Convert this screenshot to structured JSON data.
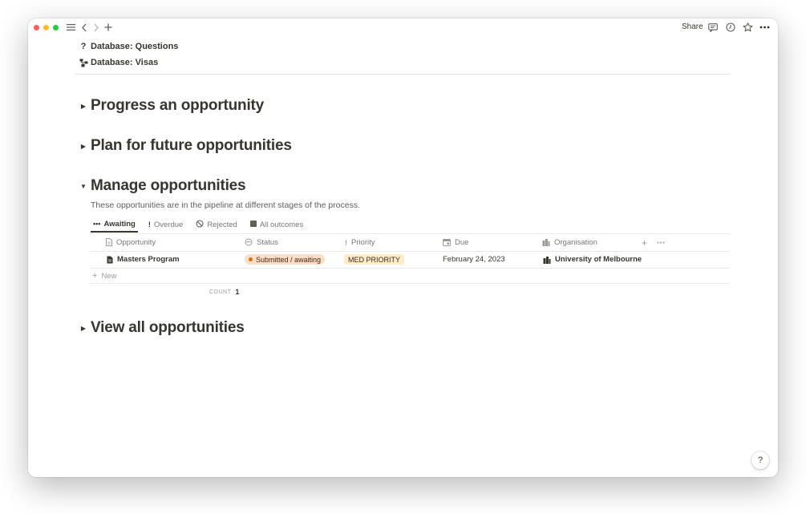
{
  "titlebar": {
    "share_label": "Share"
  },
  "links": [
    {
      "icon": "question-icon",
      "glyph": "?",
      "label": "Database: Questions"
    },
    {
      "icon": "visa-icon",
      "glyph": "⚑",
      "label": "Database: Visas"
    }
  ],
  "sections": [
    {
      "title": "Progress an opportunity",
      "expanded": false
    },
    {
      "title": "Plan for future opportunities",
      "expanded": false
    },
    {
      "title": "Manage opportunities",
      "expanded": true
    },
    {
      "title": "View all opportunities",
      "expanded": false
    }
  ],
  "manage": {
    "description": "These opportunities are in the pipeline at different stages of the process.",
    "tabs": [
      {
        "label": "Awaiting",
        "icon": "ellipsis-icon",
        "active": true
      },
      {
        "label": "Overdue",
        "icon": "exclamation-icon",
        "active": false
      },
      {
        "label": "Rejected",
        "icon": "prohibited-icon",
        "active": false
      },
      {
        "label": "All outcomes",
        "icon": "square-icon",
        "active": false
      }
    ],
    "columns": [
      "Opportunity",
      "Status",
      "Priority",
      "Due",
      "Organisation"
    ],
    "rows": [
      {
        "opportunity": "Masters Program",
        "status": "Submitted / awaiting",
        "priority": "MED PRIORITY",
        "due": "February 24, 2023",
        "organisation": "University of Melbourne"
      }
    ],
    "new_label": "New",
    "count_label": "COUNT",
    "count_value": "1"
  },
  "help_label": "?",
  "colors": {
    "status_bg": "#fadec9",
    "status_dot": "#d9730d",
    "priority_bg": "#fdecc8",
    "text": "#37352f",
    "muted": "#787774"
  }
}
